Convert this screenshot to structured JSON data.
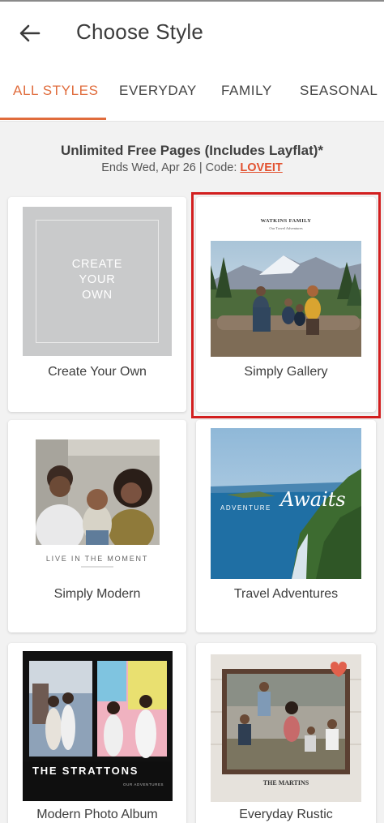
{
  "header": {
    "title": "Choose Style",
    "back_icon": "arrow-left-icon"
  },
  "tabs": [
    {
      "label": "ALL STYLES",
      "active": true
    },
    {
      "label": "EVERYDAY",
      "active": false
    },
    {
      "label": "FAMILY",
      "active": false
    },
    {
      "label": "SEASONAL",
      "active": false
    }
  ],
  "promo": {
    "title": "Unlimited Free Pages (Includes Layflat)*",
    "subtitle": "Ends Wed, Apr 26 | Code: ",
    "code": "LOVEIT"
  },
  "styles": [
    {
      "label": "Create Your Own",
      "thumb_text": "CREATE\nYOUR\nOWN",
      "selected": false
    },
    {
      "label": "Simply Gallery",
      "thumb_title": "WATKINS FAMILY",
      "thumb_subtitle": "Our Travel Adventures",
      "selected": true
    },
    {
      "label": "Simply Modern",
      "thumb_caption": "LIVE IN THE MOMENT",
      "selected": false
    },
    {
      "label": "Travel Adventures",
      "thumb_text_a": "ADVENTURE",
      "thumb_text_b": "Awaits",
      "selected": false
    },
    {
      "label": "Modern Photo Album",
      "thumb_title": "THE STRATTONS",
      "thumb_subtitle": "OUR ADVENTURES",
      "selected": false
    },
    {
      "label": "Everyday Rustic",
      "thumb_title": "THE MARTINS",
      "selected": false
    }
  ],
  "colors": {
    "accent": "#e06c3c",
    "selected_outline": "#d21f1f",
    "promo_code": "#e2512f"
  }
}
